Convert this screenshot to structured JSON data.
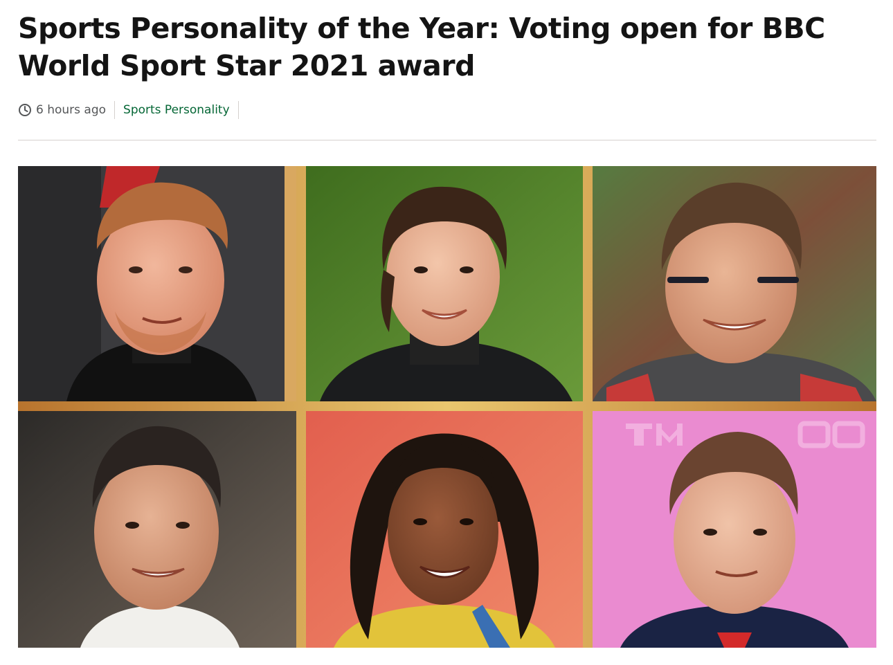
{
  "article": {
    "headline": "Sports Personality of the Year: Voting open for BBC World Sport Star 2021 award",
    "timestamp": "6 hours ago",
    "topic_link": "Sports Personality"
  },
  "hero_image": {
    "panels": [
      {
        "subject": "athlete-portrait",
        "backdrop_color": "#3a3a3c"
      },
      {
        "subject": "athlete-portrait",
        "backdrop_color": "#4f7d2a"
      },
      {
        "subject": "athlete-portrait",
        "backdrop_color": "#6e8c58"
      },
      {
        "subject": "athlete-portrait",
        "backdrop_color": "#5a4e46"
      },
      {
        "subject": "athlete-portrait",
        "backdrop_color": "#e3685a"
      },
      {
        "subject": "athlete-portrait",
        "backdrop_color": "#ea8bd0"
      }
    ],
    "backdrop_text": "TM 20"
  },
  "colors": {
    "headline": "#141414",
    "meta_text": "#545658",
    "topic_link": "#046635",
    "divider": "#d5d0cd",
    "gold_frame": "#d9a44c"
  }
}
